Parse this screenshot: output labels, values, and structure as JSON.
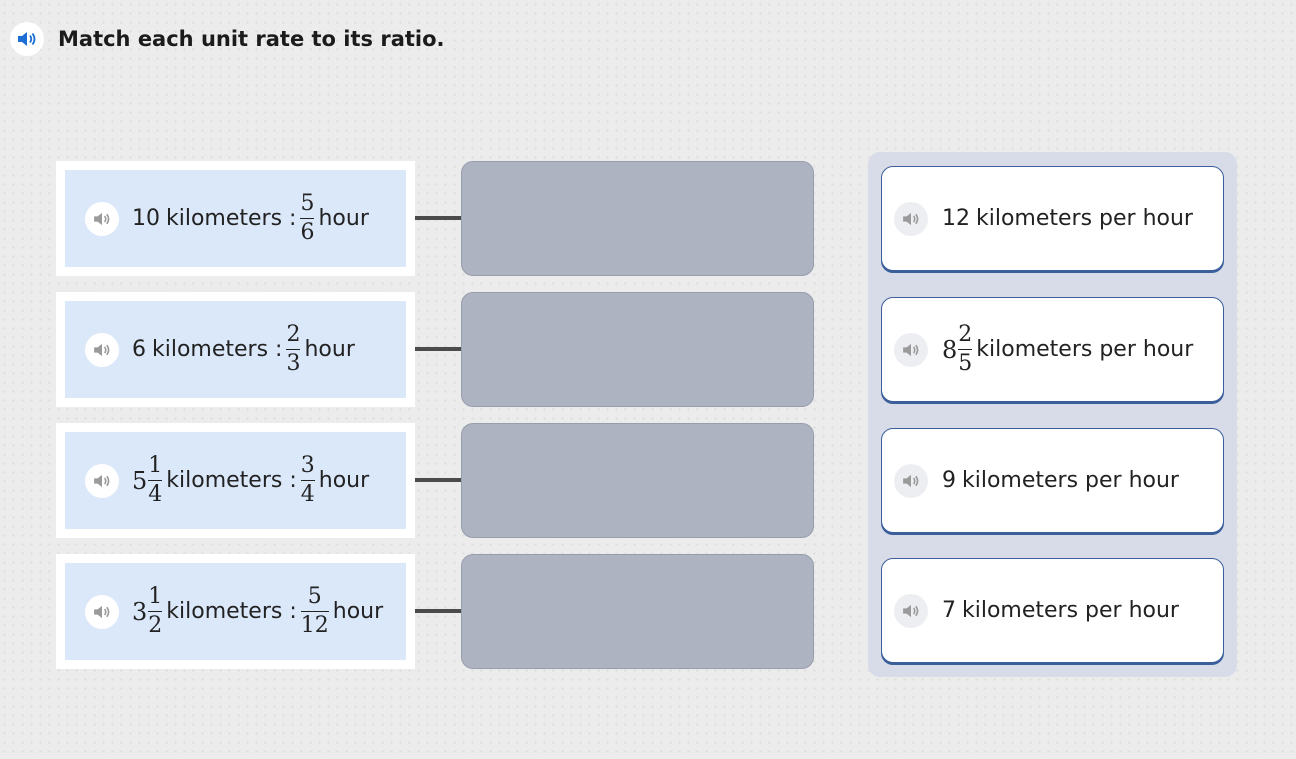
{
  "prompt": {
    "text": "Match each unit rate to its ratio.",
    "icon": "speaker-icon",
    "accent": "#1d6fd6"
  },
  "ratios": [
    {
      "whole": "",
      "num": "",
      "den": "",
      "value": "10",
      "unit1": "kilometers :",
      "fnum": "5",
      "fden": "6",
      "unit2": "hour"
    },
    {
      "whole": "",
      "num": "",
      "den": "",
      "value": "6",
      "unit1": "kilometers :",
      "fnum": "2",
      "fden": "3",
      "unit2": "hour"
    },
    {
      "whole": "5",
      "num": "1",
      "den": "4",
      "value": "",
      "unit1": "kilometers :",
      "fnum": "3",
      "fden": "4",
      "unit2": "hour"
    },
    {
      "whole": "3",
      "num": "1",
      "den": "2",
      "value": "",
      "unit1": "kilometers :",
      "fnum": "5",
      "fden": "12",
      "unit2": "hour"
    }
  ],
  "answers": [
    {
      "value": "12",
      "whole": "",
      "num": "",
      "den": "",
      "text": "kilometers per hour"
    },
    {
      "value": "",
      "whole": "8",
      "num": "2",
      "den": "5",
      "text": "kilometers per hour"
    },
    {
      "value": "9",
      "whole": "",
      "num": "",
      "den": "",
      "text": "kilometers per hour"
    },
    {
      "value": "7",
      "whole": "",
      "num": "",
      "den": "",
      "text": "kilometers per hour"
    }
  ],
  "colors": {
    "ratio_card_bg": "#dbe8fa",
    "dropzone_bg": "#adb3c1",
    "bank_bg": "#d8dce8",
    "answer_border": "#3a5f9a"
  }
}
